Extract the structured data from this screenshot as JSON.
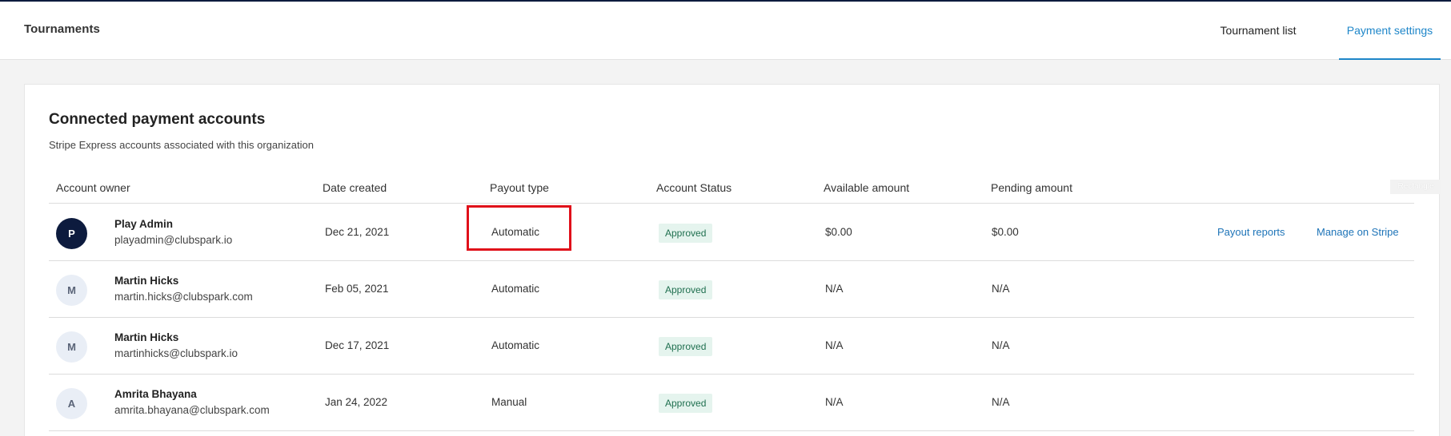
{
  "header": {
    "title": "Tournaments",
    "tabs": [
      {
        "label": "Tournament list",
        "active": false
      },
      {
        "label": "Payment settings",
        "active": true
      }
    ]
  },
  "card": {
    "title": "Connected payment accounts",
    "subtitle": "Stripe Express accounts associated with this organization",
    "columns": [
      "Account owner",
      "Date created",
      "Payout type",
      "Account Status",
      "Available amount",
      "Pending amount"
    ],
    "rows": [
      {
        "initial": "P",
        "name": "Play Admin",
        "email": "playadmin@clubspark.io",
        "date": "Dec 21, 2021",
        "payout": "Automatic",
        "status": "Approved",
        "available": "$0.00",
        "pending": "$0.00",
        "actions": [
          "Payout reports",
          "Manage on Stripe"
        ]
      },
      {
        "initial": "M",
        "name": "Martin Hicks",
        "email": "martin.hicks@clubspark.com",
        "date": "Feb 05, 2021",
        "payout": "Automatic",
        "status": "Approved",
        "available": "N/A",
        "pending": "N/A"
      },
      {
        "initial": "M",
        "name": "Martin Hicks",
        "email": "martinhicks@clubspark.io",
        "date": "Dec 17, 2021",
        "payout": "Automatic",
        "status": "Approved",
        "available": "N/A",
        "pending": "N/A"
      },
      {
        "initial": "A",
        "name": "Amrita Bhayana",
        "email": "amrita.bhayana@clubspark.com",
        "date": "Jan 24, 2022",
        "payout": "Manual",
        "status": "Approved",
        "available": "N/A",
        "pending": "N/A"
      }
    ]
  },
  "annotation": {
    "label": "Rectangle"
  },
  "colors": {
    "accent": "#1e86c9",
    "brand_dark": "#0d1b3e",
    "status_approved_bg": "#e5f4ee",
    "status_approved_text": "#1f6f4f",
    "highlight": "#e0101a"
  }
}
